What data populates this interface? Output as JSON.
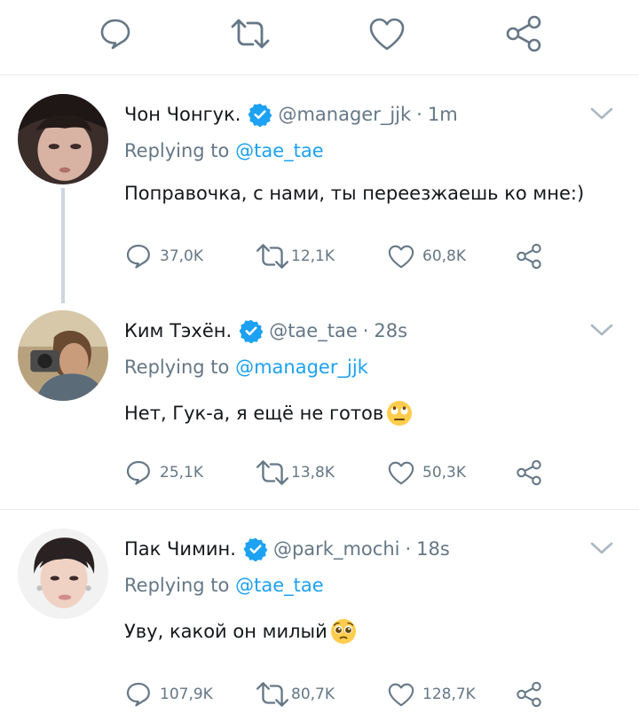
{
  "colors": {
    "accent": "#1da1f2",
    "secondary_text": "#657786",
    "divider": "#e6ecf0",
    "thread_line": "#ccd6dd"
  },
  "top_actions": {
    "icons": [
      "reply-icon",
      "retweet-icon",
      "like-icon",
      "share-icon"
    ]
  },
  "replying_prefix": "Replying to",
  "tweets": [
    {
      "name": "Чон Чонгук.",
      "handle": "@manager_jjk",
      "dot": "·",
      "time": "1m",
      "reply_to": "@tae_tae",
      "text": "Поправочка, с нами, ты переезжаешь ко мне:)",
      "emoji": "",
      "replies": "37,0K",
      "retweets": "12,1K",
      "likes": "60,8K"
    },
    {
      "name": "Ким Тэхён.",
      "handle": "@tae_tae",
      "dot": "·",
      "time": "28s",
      "reply_to": "@manager_jjk",
      "text": "Нет, Гук-а, я ещё не готов",
      "emoji": "face-with-rolling-eyes",
      "replies": "25,1K",
      "retweets": "13,8K",
      "likes": "50,3K"
    },
    {
      "name": "Пак Чимин.",
      "handle": "@park_mochi",
      "dot": "·",
      "time": "18s",
      "reply_to": "@tae_tae",
      "text": "Уву, какой он милый",
      "emoji": "pleading-face",
      "replies": "107,9K",
      "retweets": "80,7K",
      "likes": "128,7K"
    }
  ]
}
